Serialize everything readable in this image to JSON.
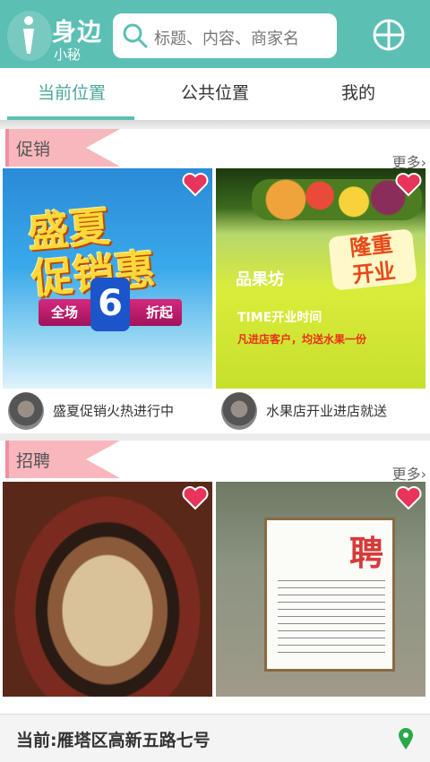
{
  "header": {
    "app_title": "身边",
    "app_subtitle": "小秘",
    "search_placeholder": "标题、内容、商家名"
  },
  "tabs": [
    {
      "label": "当前位置",
      "active": true
    },
    {
      "label": "公共位置",
      "active": false
    },
    {
      "label": "我的",
      "active": false
    }
  ],
  "sections": [
    {
      "tag": "促销",
      "more": "更多",
      "cards": [
        {
          "caption": "盛夏促销火热进行中",
          "art_text": [
            "盛夏",
            "促销惠",
            "全场",
            "6",
            "折起"
          ]
        },
        {
          "caption": "水果店开业进店就送",
          "art_text": [
            "品果坊",
            "隆重",
            "开业",
            "TIME开业时间",
            "凡进店客户，均送水果一份"
          ]
        }
      ]
    },
    {
      "tag": "招聘",
      "more": "更多",
      "cards": [
        {
          "caption": ""
        },
        {
          "caption": "",
          "art_text": [
            "聘"
          ]
        }
      ]
    }
  ],
  "footer": {
    "location": "当前:雁塔区高新五路七号"
  },
  "colors": {
    "theme": "#5bbfb3",
    "tag": "#f7b7bd",
    "heart": "#e8345a",
    "pin": "#2aa84a"
  },
  "icons": [
    "logo-icon",
    "search-icon",
    "add-circle-icon",
    "heart-icon",
    "location-pin-icon"
  ]
}
